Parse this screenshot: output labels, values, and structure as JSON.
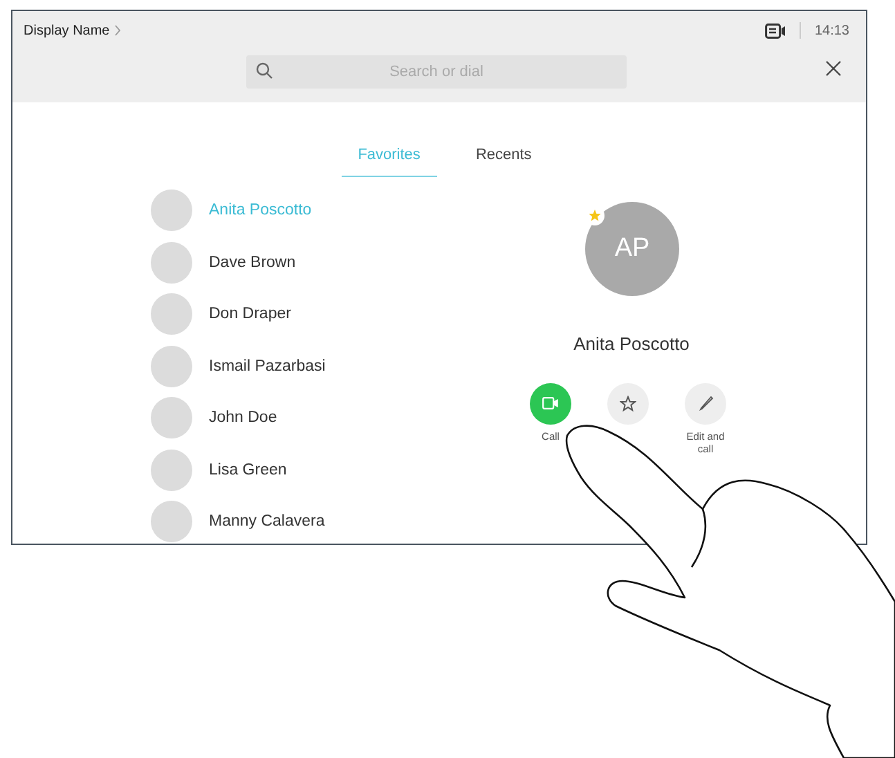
{
  "header": {
    "display_name": "Display Name",
    "time": "14:13"
  },
  "search": {
    "placeholder": "Search or dial"
  },
  "tabs": [
    {
      "label": "Favorites",
      "selected": true
    },
    {
      "label": "Recents",
      "selected": false
    }
  ],
  "contacts": [
    {
      "name": "Anita Poscotto",
      "selected": true
    },
    {
      "name": "Dave Brown",
      "selected": false
    },
    {
      "name": "Don Draper",
      "selected": false
    },
    {
      "name": "Ismail Pazarbasi",
      "selected": false
    },
    {
      "name": "John Doe",
      "selected": false
    },
    {
      "name": "Lisa Green",
      "selected": false
    },
    {
      "name": "Manny Calavera",
      "selected": false
    }
  ],
  "detail": {
    "initials": "AP",
    "favorite": true,
    "name": "Anita Poscotto",
    "actions": [
      {
        "kind": "call",
        "label": "Call"
      },
      {
        "kind": "favorite"
      },
      {
        "kind": "edit",
        "label": "Edit and call"
      }
    ]
  }
}
